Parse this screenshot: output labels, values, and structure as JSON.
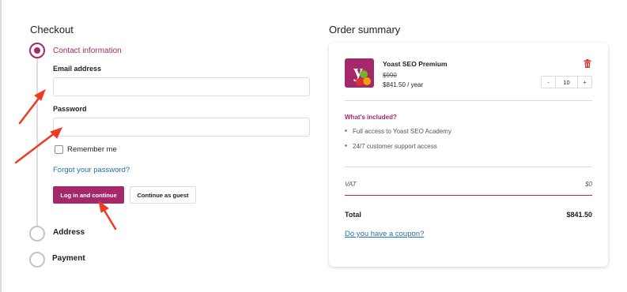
{
  "checkout": {
    "title": "Checkout",
    "steps": [
      {
        "label": "Contact information",
        "state": "active"
      },
      {
        "label": "Address",
        "state": "pending"
      },
      {
        "label": "Payment",
        "state": "pending"
      }
    ],
    "email_label": "Email address",
    "email_value": "",
    "password_label": "Password",
    "password_value": "",
    "remember_label": "Remember me",
    "forgot_link": "Forgot your password?",
    "login_button": "Log in and continue",
    "guest_button": "Continue as guest"
  },
  "summary": {
    "title": "Order summary",
    "product": {
      "name": "Yoast SEO Premium",
      "old_price": "$990",
      "new_price": "$841.50 / year",
      "quantity": "10",
      "logo_letter": "y"
    },
    "included_title": "What's included?",
    "included_items": [
      "Full access to Yoast SEO Academy",
      "24/7 customer support access"
    ],
    "vat_label": "VAT",
    "vat_value": "$0",
    "total_label": "Total",
    "total_value": "$841.50",
    "coupon_link": "Do you have a coupon?"
  },
  "colors": {
    "accent": "#a4286a",
    "link": "#2271b1",
    "annotation_arrow": "#ee3b24"
  },
  "icons": {
    "remove": "trash-icon",
    "quantity_decrease": "minus-icon",
    "quantity_increase": "plus-icon",
    "annotations": "red-arrow-icon"
  }
}
